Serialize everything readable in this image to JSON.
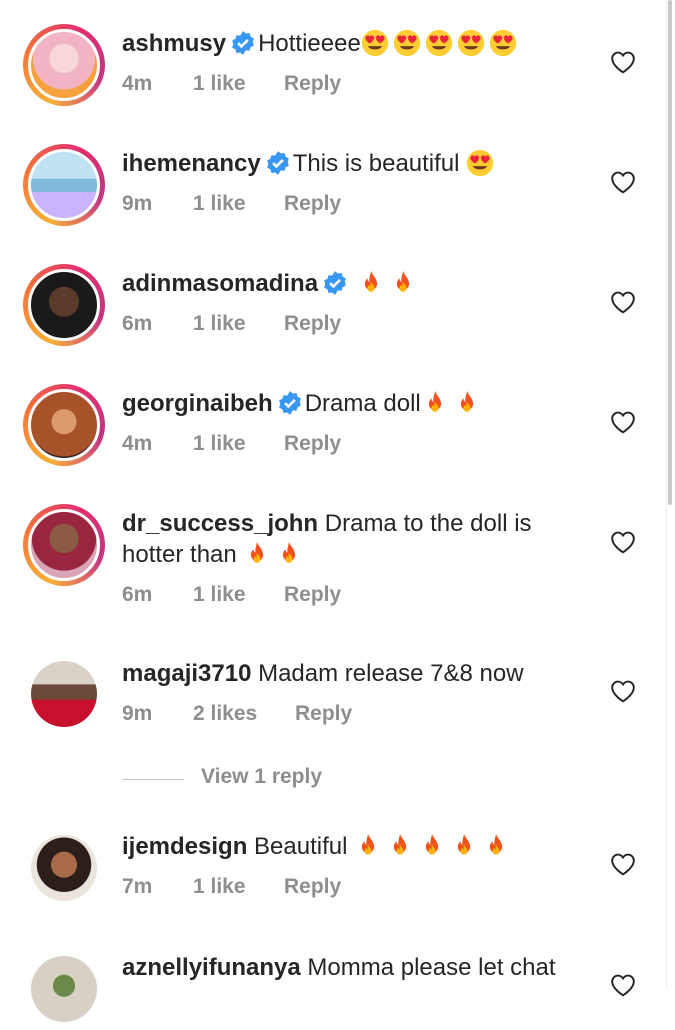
{
  "colors": {
    "text_primary": "#262626",
    "text_secondary": "#8e8e8e",
    "verified_blue": "#3897f0",
    "story_ring": [
      "#f9b13a",
      "#e1306c",
      "#c13584"
    ]
  },
  "icons": {
    "verified": "verified-badge-icon",
    "like": "heart-outline-icon",
    "heart_eyes": "heart-eyes-emoji",
    "fire": "fire-emoji"
  },
  "comments": [
    {
      "username": "ashmusy",
      "verified": true,
      "text": "Hottieeee",
      "emoji": "heart_eyes",
      "emoji_count": 5,
      "time": "4m",
      "likes": "1 like",
      "reply": "Reply",
      "story_ring": true
    },
    {
      "username": "ihemenancy",
      "verified": true,
      "text": "This is beautiful ",
      "emoji": "heart_eyes",
      "emoji_count": 1,
      "time": "9m",
      "likes": "1 like",
      "reply": "Reply",
      "story_ring": true
    },
    {
      "username": "adinmasomadina",
      "verified": true,
      "text": " ",
      "emoji": "fire",
      "emoji_count": 2,
      "time": "6m",
      "likes": "1 like",
      "reply": "Reply",
      "story_ring": true
    },
    {
      "username": "georginaibeh",
      "verified": true,
      "text": "Drama doll",
      "emoji": "fire",
      "emoji_count": 2,
      "time": "4m",
      "likes": "1 like",
      "reply": "Reply",
      "story_ring": true
    },
    {
      "username": "dr_success_john",
      "verified": false,
      "text": "Drama to the doll is hotter than ",
      "emoji": "fire",
      "emoji_count": 2,
      "time": "6m",
      "likes": "1 like",
      "reply": "Reply",
      "story_ring": true
    },
    {
      "username": "magaji3710",
      "verified": false,
      "text": "Madam release 7&8 now",
      "emoji": "none",
      "emoji_count": 0,
      "time": "9m",
      "likes": "2 likes",
      "reply": "Reply",
      "story_ring": false
    },
    {
      "username": "ijemdesign",
      "verified": false,
      "text": "Beautiful ",
      "emoji": "fire",
      "emoji_count": 5,
      "time": "7m",
      "likes": "1 like",
      "reply": "Reply",
      "story_ring": false
    },
    {
      "username": "aznellyifunanya",
      "verified": false,
      "text": "Momma please let chat",
      "emoji": "none",
      "emoji_count": 0,
      "time": "",
      "likes": "",
      "reply": "",
      "story_ring": false
    }
  ],
  "view_replies": "View 1 reply"
}
